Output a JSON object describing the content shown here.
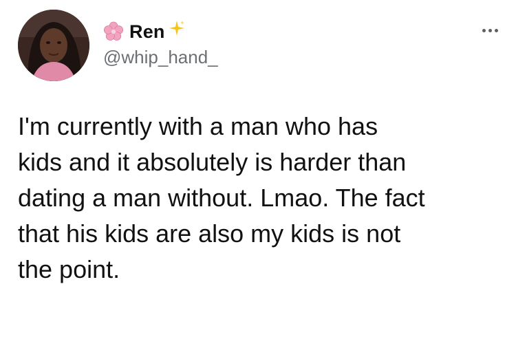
{
  "author": {
    "display_name": "Ren",
    "handle": "@whip_hand_",
    "name_prefix_icon": "cherry-blossom-icon",
    "name_suffix_icon": "sparkle-icon"
  },
  "menu": {
    "icon": "more-options-icon"
  },
  "tweet": {
    "text": "I'm currently with a man who has\nkids and it absolutely is harder than\ndating a man without. Lmao. The fact\nthat his kids are also my kids is not\nthe point."
  },
  "colors": {
    "handle": "#6b6f74",
    "text": "#111111",
    "flower": "#f2a3c0",
    "sparkle": "#f5c518"
  }
}
